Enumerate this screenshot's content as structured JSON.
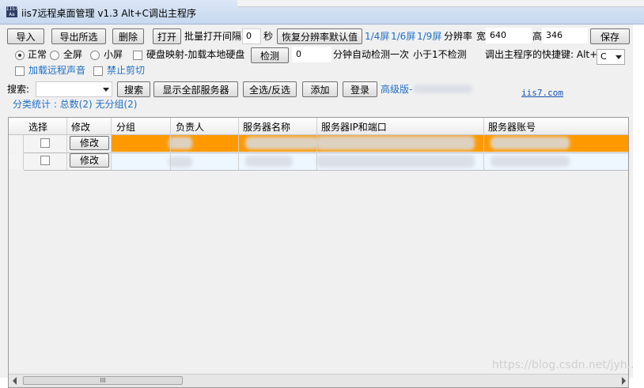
{
  "titlebar": {
    "icon_text": "IIS7 Aa",
    "title": "iis7远程桌面管理 v1.3 Alt+C调出主程序"
  },
  "toolbar1": {
    "import": "导入",
    "export": "导出所选",
    "delete": "删除",
    "open": "打开",
    "batch_interval_label": "批量打开间隔",
    "batch_interval_value": "0",
    "seconds": "秒",
    "restore_resolution": "恢复分辨率默认值",
    "quarter": "1/4屏",
    "sixth": "1/6屏",
    "ninth": "1/9屏",
    "resolution_label": "分辨率",
    "width_label": "宽",
    "width_value": "640",
    "height_label": "高",
    "height_value": "346",
    "save": "保存"
  },
  "toolbar2": {
    "normal": "正常",
    "full": "全屏",
    "small": "小屏",
    "disk_map": "硬盘映射-加载本地硬盘",
    "detect": "检测",
    "detect_value": "0",
    "minute_auto": "分钟自动检测一次",
    "less_than_1": "小于1不检测",
    "hotkey_label": "调出主程序的快捷键: Alt+",
    "hotkey_value": "C"
  },
  "toolbar3": {
    "remote_sound": "加载远程声音",
    "disable_clipboard": "禁止剪切"
  },
  "toolbar4": {
    "search_label": "搜索:",
    "search_button": "搜索",
    "show_all": "显示全部服务器",
    "select_all": "全选/反选",
    "add": "添加",
    "login": "登录",
    "advanced": "高级版-",
    "site_link": "iis7.com"
  },
  "stats": {
    "text": "分类统计 : 总数(2) 无分组(2)"
  },
  "table": {
    "headers": [
      "选择",
      "修改",
      "分组",
      "负责人",
      "服务器名称",
      "服务器IP和端口",
      "服务器账号"
    ],
    "rows": [
      {
        "edit": "修改",
        "highlight": "#ff9900"
      },
      {
        "edit": "修改",
        "highlight": "#eef6ff"
      }
    ]
  },
  "scroll": {
    "thumb_label": "III"
  },
  "watermark": "https://blog.csdn.net/jyh..."
}
